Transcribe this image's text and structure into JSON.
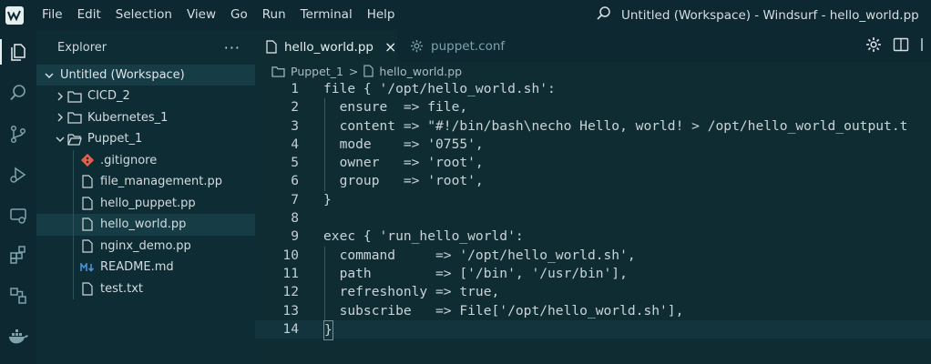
{
  "window": {
    "title": "Untitled (Workspace) - Windsurf - hello_world.pp",
    "menu": [
      "File",
      "Edit",
      "Selection",
      "View",
      "Go",
      "Run",
      "Terminal",
      "Help"
    ]
  },
  "activity_bar": {
    "icons": [
      "files-icon",
      "search-icon",
      "source-control-icon",
      "run-debug-icon",
      "remote-explorer-icon",
      "extensions-icon",
      "timeline-icon",
      "docker-icon"
    ]
  },
  "sidebar": {
    "title": "Explorer",
    "more": "···",
    "workspace": "Untitled (Workspace)",
    "items": [
      {
        "label": "CICD_2",
        "type": "folder",
        "state": "collapsed"
      },
      {
        "label": "Kubernetes_1",
        "type": "folder",
        "state": "collapsed"
      },
      {
        "label": "Puppet_1",
        "type": "folder",
        "state": "expanded"
      },
      {
        "label": ".gitignore",
        "type": "git"
      },
      {
        "label": "file_management.pp",
        "type": "file"
      },
      {
        "label": "hello_puppet.pp",
        "type": "file"
      },
      {
        "label": "hello_world.pp",
        "type": "file",
        "selected": true
      },
      {
        "label": "nginx_demo.pp",
        "type": "file"
      },
      {
        "label": "README.md",
        "type": "markdown"
      },
      {
        "label": "test.txt",
        "type": "file"
      }
    ]
  },
  "tabs": [
    {
      "label": "hello_world.pp",
      "active": true,
      "close": "×"
    },
    {
      "label": "puppet.conf",
      "active": false
    }
  ],
  "breadcrumb": [
    "Puppet_1",
    "hello_world.pp"
  ],
  "breadcrumb_sep": ">",
  "code": {
    "lines": [
      {
        "n": "1",
        "text": "file { '/opt/hello_world.sh':"
      },
      {
        "n": "2",
        "text": "  ensure  => file,"
      },
      {
        "n": "3",
        "text": "  content => \"#!/bin/bash\\necho Hello, world! > /opt/hello_world_output.t"
      },
      {
        "n": "4",
        "text": "  mode    => '0755',"
      },
      {
        "n": "5",
        "text": "  owner   => 'root',"
      },
      {
        "n": "6",
        "text": "  group   => 'root',"
      },
      {
        "n": "7",
        "text": "}"
      },
      {
        "n": "8",
        "text": ""
      },
      {
        "n": "9",
        "text": "exec { 'run_hello_world':"
      },
      {
        "n": "10",
        "text": "  command     => '/opt/hello_world.sh',"
      },
      {
        "n": "11",
        "text": "  path        => ['/bin', '/usr/bin'],"
      },
      {
        "n": "12",
        "text": "  refreshonly => true,"
      },
      {
        "n": "13",
        "text": "  subscribe   => File['/opt/hello_world.sh'],"
      },
      {
        "n": "14",
        "text": "}"
      }
    ]
  },
  "colors": {
    "background": "#0f2c33",
    "chrome": "#0d2830",
    "selection": "#163c45",
    "git_icon": "#e0604a",
    "markdown_icon": "#4a90d9"
  }
}
